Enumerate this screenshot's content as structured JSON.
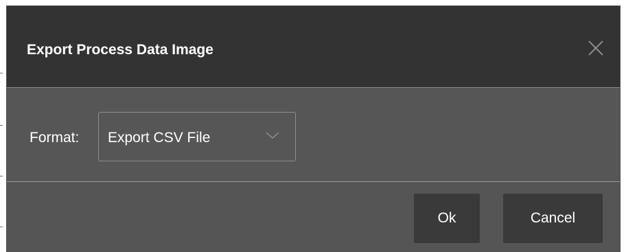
{
  "dialog": {
    "title": "Export Process Data Image",
    "close_icon": "close-icon"
  },
  "form": {
    "format_label": "Format:",
    "format_value": "Export CSV File",
    "format_chevron_icon": "chevron-down-icon"
  },
  "footer": {
    "ok_label": "Ok",
    "cancel_label": "Cancel"
  },
  "colors": {
    "header_bg": "#333333",
    "body_bg": "#565656",
    "button_bg": "#3a3a3a",
    "text": "#ffffff"
  }
}
